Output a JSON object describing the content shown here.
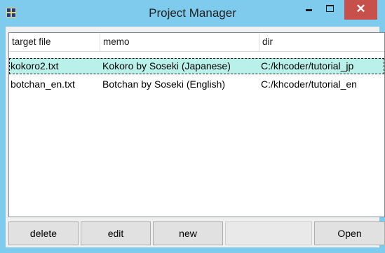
{
  "window": {
    "title": "Project Manager",
    "close_symbol": "✕",
    "icons": {
      "app": "app-grid-icon",
      "minimize": "minimize-icon",
      "maximize": "maximize-icon",
      "close": "close-icon"
    },
    "colors": {
      "titlebar": "#7fcbed",
      "close": "#c7504a",
      "selection": "#b9f1ea"
    }
  },
  "table": {
    "columns": [
      "target file",
      "memo",
      "dir"
    ],
    "rows": [
      {
        "file": "kokoro2.txt",
        "memo": "Kokoro by Soseki (Japanese)",
        "dir": "C:/khcoder/tutorial_jp",
        "selected": true
      },
      {
        "file": "botchan_en.txt",
        "memo": "Botchan by Soseki (English)",
        "dir": "C:/khcoder/tutorial_en",
        "selected": false
      }
    ]
  },
  "buttons": {
    "delete": "delete",
    "edit": "edit",
    "new": "new",
    "open": "Open"
  }
}
